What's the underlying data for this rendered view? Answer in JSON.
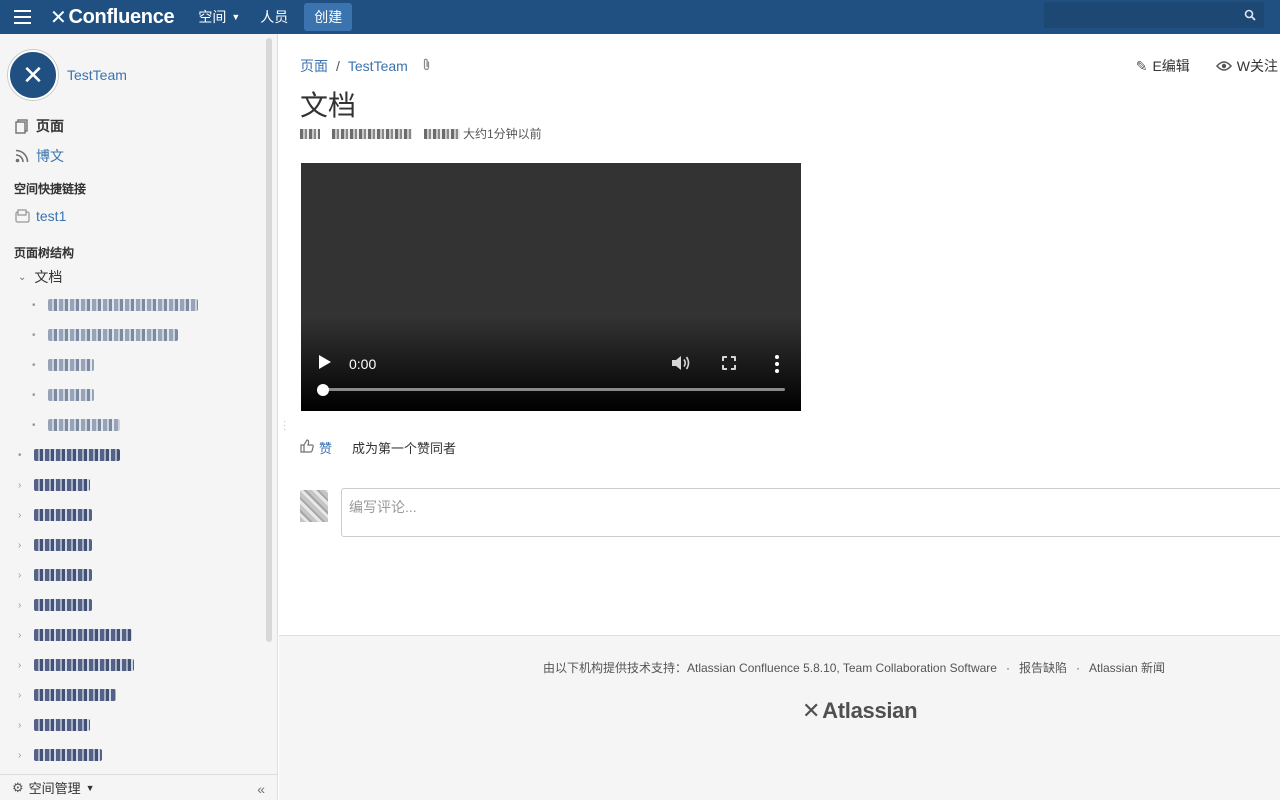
{
  "header": {
    "brand": "Confluence",
    "nav": {
      "spaces": "空间",
      "people": "人员",
      "create": "创建"
    },
    "search_icon": "search-icon"
  },
  "sidebar": {
    "space_name": "TestTeam",
    "links": {
      "pages": "页面",
      "blog": "博文"
    },
    "shortcuts_heading": "空间快捷链接",
    "shortcuts": [
      "test1"
    ],
    "tree_heading": "页面树结构",
    "tree_root": "文档",
    "footer": {
      "space_tools": "空间管理"
    }
  },
  "page": {
    "breadcrumb": {
      "root": "页面",
      "space": "TestTeam"
    },
    "actions": {
      "edit": "E编辑",
      "watch": "W关注"
    },
    "title": "文档",
    "meta_time": "大约1分钟以前",
    "video": {
      "time": "0:00",
      "progress": 0
    },
    "like": {
      "label": "赞",
      "first_text": "成为第一个赞同者"
    },
    "comment_placeholder": "编写评论..."
  },
  "footer": {
    "powered_by": "由以下机构提供技术支持：Atlassian Confluence 5.8.10, Team Collaboration Software",
    "report_bug": "报告缺陷",
    "news": "Atlassian 新闻",
    "logo": "Atlassian"
  },
  "colors": {
    "header": "#205081",
    "link": "#3b73af",
    "sidebar_bg": "#f5f5f5"
  }
}
